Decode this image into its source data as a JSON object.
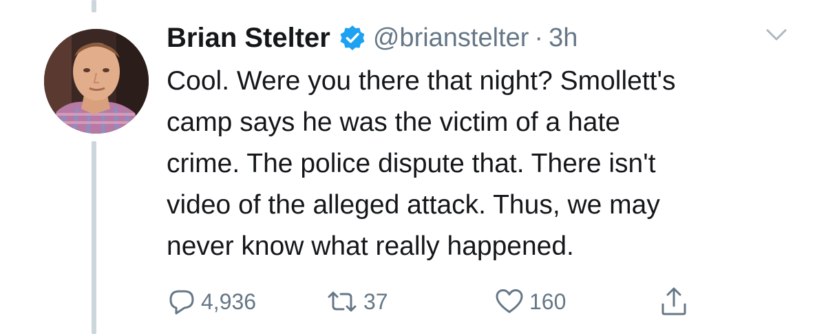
{
  "tweet": {
    "author_name": "Brian Stelter",
    "handle": "@brianstelter",
    "separator": "·",
    "timestamp": "3h",
    "verified": true,
    "text_lines": [
      "Cool. Were you there that night? Smollett's",
      "camp says he was the victim of a hate",
      "crime. The police dispute that. There isn't",
      "video of the alleged attack. Thus, we may",
      "never know what really happened."
    ],
    "actions": {
      "reply_count": "4,936",
      "retweet_count": "37",
      "like_count": "160"
    }
  },
  "icons": {
    "verified": "verified-badge-icon",
    "caret": "chevron-down-icon",
    "reply": "reply-icon",
    "retweet": "retweet-icon",
    "like": "heart-icon",
    "share": "share-icon"
  },
  "colors": {
    "text": "#14171a",
    "secondary": "#657786",
    "verified_blue": "#1da1f2",
    "thread_line": "#ccd6dd",
    "caret": "#aab8c2"
  }
}
